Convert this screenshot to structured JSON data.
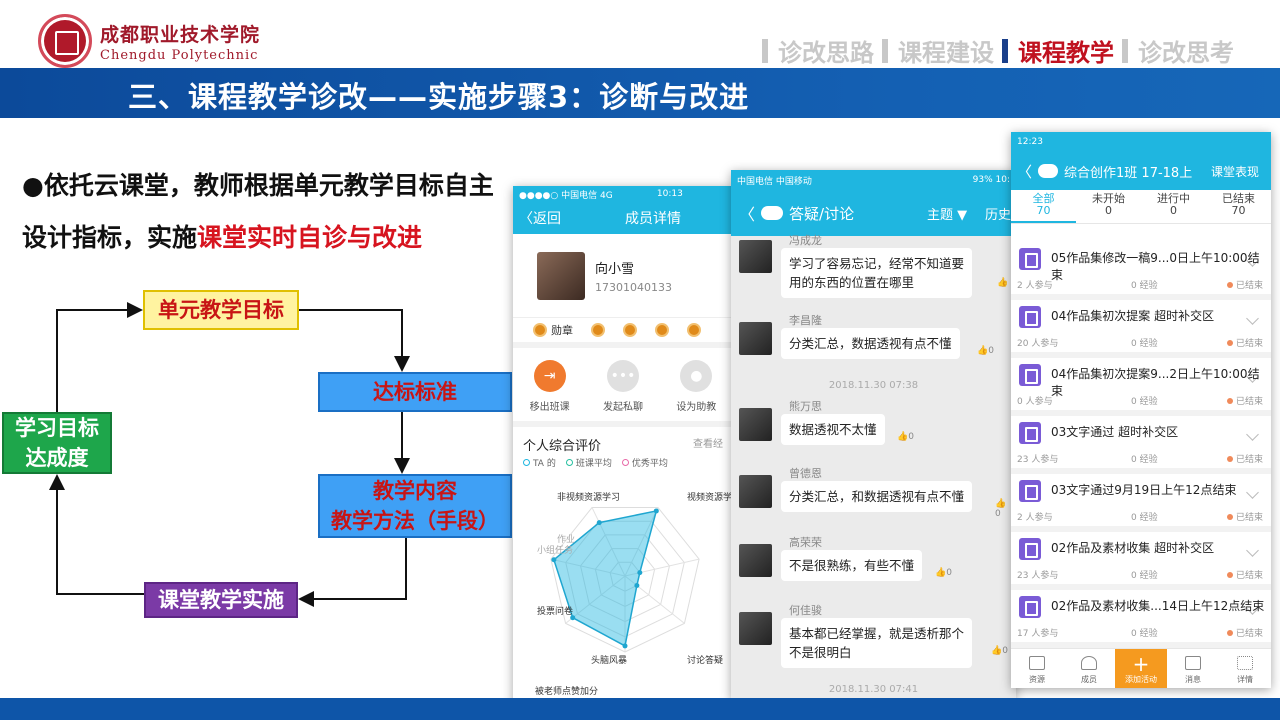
{
  "header": {
    "logo_cn": "成都职业技术学院",
    "logo_en": "Chengdu Polytechnic",
    "nav": [
      {
        "label": "诊改思路",
        "active": false
      },
      {
        "label": "课程建设",
        "active": false
      },
      {
        "label": "课程教学",
        "active": true
      },
      {
        "label": "诊改思考",
        "active": false
      }
    ],
    "slide_title": "三、课程教学诊改——实施步骤3：诊断与改进"
  },
  "bullet": {
    "prefix": "●依托云课堂，教师根据单元教学目标自主设计指标，实施",
    "highlight": "课堂实时自诊与改进"
  },
  "flowchart": {
    "goal": "单元教学目标",
    "standard": "达标标准",
    "content_line1": "教学内容",
    "content_line2": "教学方法（手段）",
    "implementation": "课堂教学实施",
    "achieve_line1": "学习目标",
    "achieve_line2": "达成度"
  },
  "phone_member": {
    "status_left": "●●●●○ 中国电信  4G",
    "status_time": "10:13",
    "back_label": "〈返回",
    "title": "成员详情",
    "name": "向小雪",
    "phone": "17301040133",
    "medal_label": "勋章",
    "actions": [
      {
        "label": "移出班课",
        "icon": "remove-icon"
      },
      {
        "label": "发起私聊",
        "icon": "chat-icon"
      },
      {
        "label": "设为助教",
        "icon": "person-icon"
      }
    ],
    "eval_title": "个人综合评价",
    "eval_more": "查看经",
    "legend": [
      "TA 的",
      "班课平均",
      "优秀平均"
    ],
    "radar_labels": [
      "非视频资源学习",
      "视频资源学",
      "作业",
      "小组任务",
      "投票问卷",
      "头脑风暴",
      "讨论答疑",
      "被老师点赞加分"
    ],
    "radar_values": [
      0.78,
      0.95,
      0.2,
      0.2,
      0.92,
      0.88,
      0.96,
      0.6
    ]
  },
  "phone_discuss": {
    "status_left": "中国电信 中国移动",
    "status_right": "93%  10:",
    "title": "答疑/讨论",
    "filter": "主题 ▼",
    "history": "历史",
    "messages": [
      {
        "name": "冯成龙",
        "text1": "学习了容易忘记，经常不知道要",
        "text2": "用的东西的位置在哪里",
        "likes": ""
      },
      {
        "name": "李昌隆",
        "text1": "分类汇总，数据透视有点不懂",
        "text2": "",
        "likes": "0"
      },
      {
        "name": "熊万思",
        "text1": "数据透视不太懂",
        "text2": "",
        "likes": "0"
      },
      {
        "name": "曾德恩",
        "text1": "分类汇总，和数据透视有点不懂",
        "text2": "",
        "likes": "0"
      },
      {
        "name": "高荣荣",
        "text1": "不是很熟练，有些不懂",
        "text2": "",
        "likes": "0"
      },
      {
        "name": "何佳骏",
        "text1": "基本都已经掌握，就是透析那个",
        "text2": "不是很明白",
        "likes": "0"
      }
    ],
    "timestamps": [
      "2018.11.30 07:38",
      "2018.11.30 07:41"
    ]
  },
  "phone_activities": {
    "status_left": "12:23",
    "title": "综合创作1班 17-18上",
    "right_label": "课堂表现",
    "tabs": [
      {
        "label": "全部",
        "count": "70",
        "active": true
      },
      {
        "label": "未开始",
        "count": "0",
        "active": false
      },
      {
        "label": "进行中",
        "count": "0",
        "active": false
      },
      {
        "label": "已结束",
        "count": "70",
        "active": false
      }
    ],
    "rows": [
      {
        "title": "05作品集修改一稿9...0日上午10:00结束",
        "participants": "2 人参与",
        "exp": "0 经验",
        "status": "已结束"
      },
      {
        "title": "04作品集初次提案 超时补交区",
        "participants": "20 人参与",
        "exp": "0 经验",
        "status": "已结束"
      },
      {
        "title": "04作品集初次提案9...2日上午10:00结束",
        "participants": "0 人参与",
        "exp": "0 经验",
        "status": "已结束"
      },
      {
        "title": "03文字通过 超时补交区",
        "participants": "23 人参与",
        "exp": "0 经验",
        "status": "已结束"
      },
      {
        "title": "03文字通过9月19日上午12点结束",
        "participants": "2 人参与",
        "exp": "0 经验",
        "status": "已结束"
      },
      {
        "title": "02作品及素材收集 超时补交区",
        "participants": "23 人参与",
        "exp": "0 经验",
        "status": "已结束"
      },
      {
        "title": "02作品及素材收集...14日上午12点结束",
        "participants": "17 人参与",
        "exp": "0 经验",
        "status": "已结束"
      }
    ],
    "footer": [
      {
        "label": "资源",
        "icon": "folder-icon"
      },
      {
        "label": "成员",
        "icon": "member-icon"
      },
      {
        "label": "添加活动",
        "icon": "plus-icon"
      },
      {
        "label": "消息",
        "icon": "message-icon"
      },
      {
        "label": "详情",
        "icon": "grid-icon"
      }
    ]
  }
}
